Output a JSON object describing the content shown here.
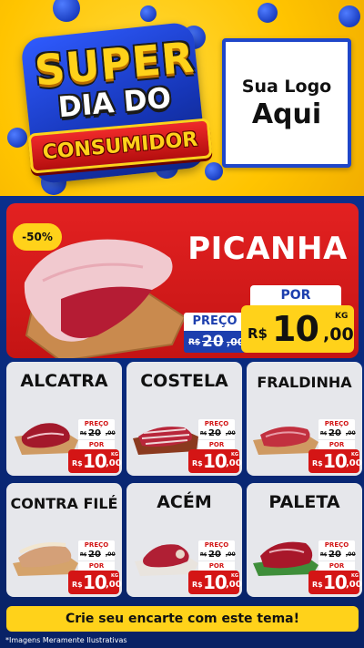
{
  "header": {
    "badge_line1": "SUPER",
    "badge_line2": "DIA DO",
    "badge_line3": "CONSUMIDOR",
    "logo_line1": "Sua Logo",
    "logo_line2": "Aqui"
  },
  "featured": {
    "discount": "-50%",
    "name": "PICANHA",
    "preco_label": "PREÇO",
    "old_currency": "R$",
    "old_int": "20",
    "old_dec": ",00",
    "por_label": "POR",
    "currency": "R$",
    "price_int": "10",
    "price_dec": ",00",
    "unit": "KG"
  },
  "products": [
    {
      "name": "ALCATRA",
      "preco_label": "PREÇO",
      "old_currency": "R$",
      "old_int": "20",
      "old_dec": ",00",
      "por_label": "POR",
      "currency": "R$",
      "price_int": "10",
      "price_dec": ",00",
      "unit": "KG"
    },
    {
      "name": "COSTELA",
      "preco_label": "PREÇO",
      "old_currency": "R$",
      "old_int": "20",
      "old_dec": ",00",
      "por_label": "POR",
      "currency": "R$",
      "price_int": "10",
      "price_dec": ",00",
      "unit": "KG"
    },
    {
      "name": "FRALDINHA",
      "preco_label": "PREÇO",
      "old_currency": "R$",
      "old_int": "20",
      "old_dec": ",00",
      "por_label": "POR",
      "currency": "R$",
      "price_int": "10",
      "price_dec": ",00",
      "unit": "KG"
    },
    {
      "name": "CONTRA FILÉ",
      "preco_label": "PREÇO",
      "old_currency": "R$",
      "old_int": "20",
      "old_dec": ",00",
      "por_label": "POR",
      "currency": "R$",
      "price_int": "10",
      "price_dec": ",00",
      "unit": "KG"
    },
    {
      "name": "ACÉM",
      "preco_label": "PREÇO",
      "old_currency": "R$",
      "old_int": "20",
      "old_dec": ",00",
      "por_label": "POR",
      "currency": "R$",
      "price_int": "10",
      "price_dec": ",00",
      "unit": "KG"
    },
    {
      "name": "PALETA",
      "preco_label": "PREÇO",
      "old_currency": "R$",
      "old_int": "20",
      "old_dec": ",00",
      "por_label": "POR",
      "currency": "R$",
      "price_int": "10",
      "price_dec": ",00",
      "unit": "KG"
    }
  ],
  "cta_label": "Crie seu encarte com este tema!",
  "disclaimer": "*Imagens Meramente Ilustrativas",
  "colors": {
    "brand_yellow": "#ffd21a",
    "brand_blue": "#0a2f8c",
    "brand_red": "#d41515"
  }
}
